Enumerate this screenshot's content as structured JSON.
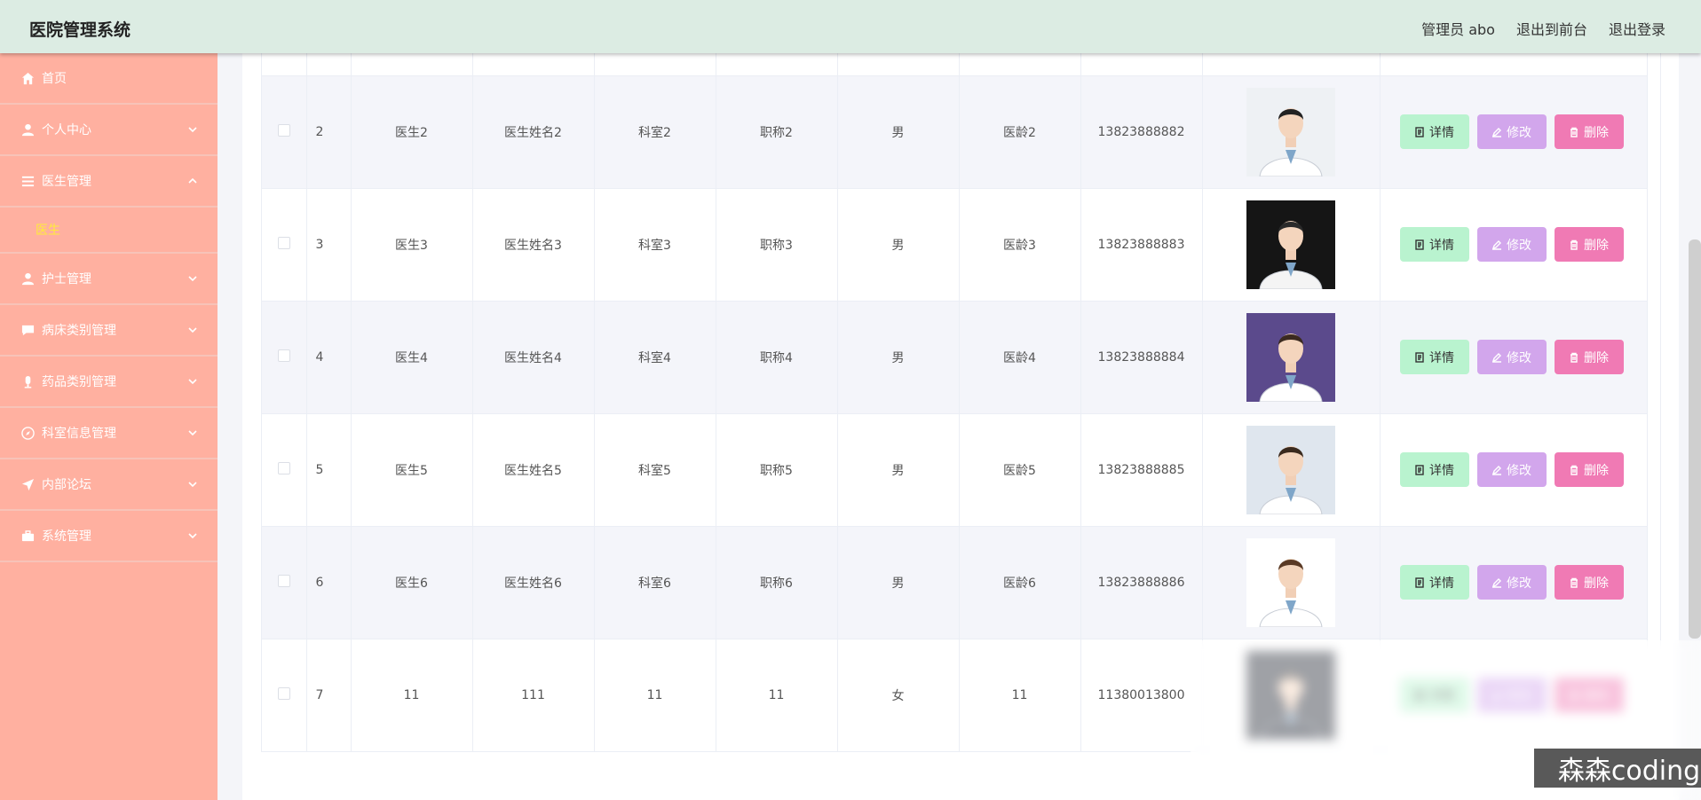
{
  "header": {
    "title": "医院管理系统",
    "admin": "管理员 abo",
    "to_front": "退出到前台",
    "logout": "退出登录"
  },
  "sidebar": {
    "items": [
      {
        "label": "首页",
        "icon": "home-icon"
      },
      {
        "label": "个人中心",
        "icon": "user-icon"
      },
      {
        "label": "医生管理",
        "icon": "list-icon"
      },
      {
        "label": "医生",
        "icon": ""
      },
      {
        "label": "护士管理",
        "icon": "user-icon"
      },
      {
        "label": "病床类别管理",
        "icon": "chat-icon"
      },
      {
        "label": "药品类别管理",
        "icon": "mic-icon"
      },
      {
        "label": "科室信息管理",
        "icon": "compass-icon"
      },
      {
        "label": "内部论坛",
        "icon": "send-icon"
      },
      {
        "label": "系统管理",
        "icon": "briefcase-icon"
      }
    ]
  },
  "table": {
    "rows": [
      {
        "id": "2",
        "account": "医生2",
        "name": "医生姓名2",
        "dept": "科室2",
        "title": "职称2",
        "gender": "男",
        "age": "医龄2",
        "phone": "13823888882"
      },
      {
        "id": "3",
        "account": "医生3",
        "name": "医生姓名3",
        "dept": "科室3",
        "title": "职称3",
        "gender": "男",
        "age": "医龄3",
        "phone": "13823888883"
      },
      {
        "id": "4",
        "account": "医生4",
        "name": "医生姓名4",
        "dept": "科室4",
        "title": "职称4",
        "gender": "男",
        "age": "医龄4",
        "phone": "13823888884"
      },
      {
        "id": "5",
        "account": "医生5",
        "name": "医生姓名5",
        "dept": "科室5",
        "title": "职称5",
        "gender": "男",
        "age": "医龄5",
        "phone": "13823888885"
      },
      {
        "id": "6",
        "account": "医生6",
        "name": "医生姓名6",
        "dept": "科室6",
        "title": "职称6",
        "gender": "男",
        "age": "医龄6",
        "phone": "13823888886"
      },
      {
        "id": "7",
        "account": "11",
        "name": "111",
        "dept": "11",
        "title": "11",
        "gender": "女",
        "age": "11",
        "phone": "11380013800"
      }
    ],
    "actions": {
      "detail": "详情",
      "edit": "修改",
      "delete": "删除"
    }
  },
  "watermark": "森森coding"
}
